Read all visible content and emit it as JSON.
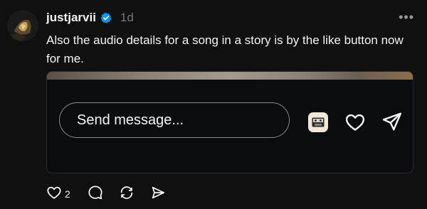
{
  "post": {
    "username": "justjarvii",
    "time": "1d",
    "text": "Also the audio details for a song in a story is by the like button now for me.",
    "more_label": "•••"
  },
  "media": {
    "message_placeholder": "Send message..."
  },
  "actions": {
    "like_count": "2"
  },
  "colors": {
    "background": "#101010",
    "verified_blue": "#0095f6",
    "text": "#f3f5f7",
    "muted": "#777777"
  },
  "icons": [
    "avatar",
    "verified-badge-icon",
    "more-icon",
    "audio-cassette-icon",
    "heart-icon",
    "paper-plane-icon",
    "comment-icon",
    "repost-icon",
    "share-icon"
  ]
}
